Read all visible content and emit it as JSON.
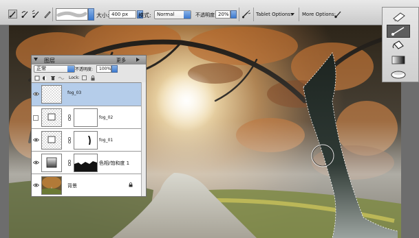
{
  "options_bar": {
    "size_label": "大小:",
    "size_value": "400 px",
    "mode_label": "模式:",
    "mode_value": "Normal",
    "opacity_label": "不透明度:",
    "opacity_value": "20%",
    "tablet_options": "Tablet Options:",
    "more_options": "More Options:"
  },
  "layers_panel": {
    "title": "图层",
    "more": "更多",
    "blend_mode": "正常",
    "opacity_label": "不透明度:",
    "opacity_value": "100%",
    "lock_label": "Lock:",
    "layers": [
      {
        "name": "fog_03",
        "visible": true,
        "selected": true
      },
      {
        "name": "fog_02",
        "visible": false,
        "selected": false
      },
      {
        "name": "fog_01",
        "visible": true,
        "selected": false
      },
      {
        "name": "色相/饱和度 1",
        "visible": true,
        "selected": false
      },
      {
        "name": "背景",
        "visible": true,
        "selected": false
      }
    ]
  },
  "toolbox": {
    "tools": [
      "eraser-icon",
      "brush-icon",
      "paint-bucket-icon",
      "gradient-icon",
      "smudge-icon"
    ],
    "active_tool": "brush-icon"
  },
  "colors": {
    "selected_layer": "#b5cdea",
    "panel_bg": "#e4e4e4",
    "accent_blue": "#3a78cf"
  }
}
